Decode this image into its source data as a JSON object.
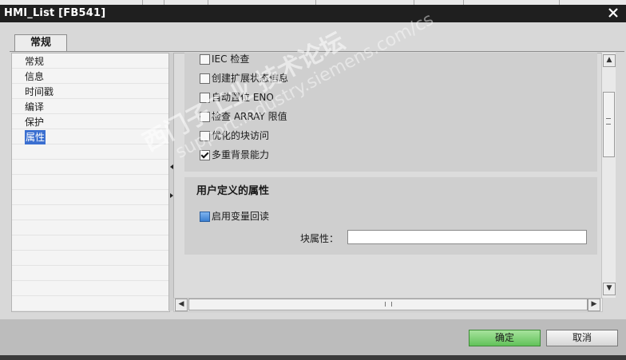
{
  "window": {
    "title": "HMI_List [FB541]"
  },
  "tabs": [
    {
      "label": "常规",
      "active": true
    }
  ],
  "nav": {
    "items": [
      {
        "label": "常规"
      },
      {
        "label": "信息"
      },
      {
        "label": "时间戳"
      },
      {
        "label": "编译"
      },
      {
        "label": "保护"
      },
      {
        "label": "属性",
        "selected": true
      }
    ]
  },
  "properties": {
    "checkboxes": [
      {
        "label": "IEC 检查",
        "checked": false
      },
      {
        "label": "创建扩展状态信息",
        "checked": false
      },
      {
        "label": "自动置位 ENO",
        "checked": false
      },
      {
        "label": "检查 ARRAY 限值",
        "checked": false
      },
      {
        "label": "优化的块访问",
        "checked": false
      },
      {
        "label": "多重背景能力",
        "checked": true
      }
    ]
  },
  "user_attributes": {
    "title": "用户定义的属性",
    "readback_label": "启用变量回读",
    "readback_checked": false,
    "block_attr_label": "块属性：",
    "block_attr_value": ""
  },
  "buttons": {
    "ok": "确定",
    "cancel": "取消"
  },
  "watermark": {
    "line1": "西门子工业  技术论坛",
    "line2": "support.industry.siemens.com/cs"
  },
  "colors": {
    "selection": "#3b6fd0",
    "ok_button": "#62c25a",
    "titlebar": "#1f1f1f"
  }
}
